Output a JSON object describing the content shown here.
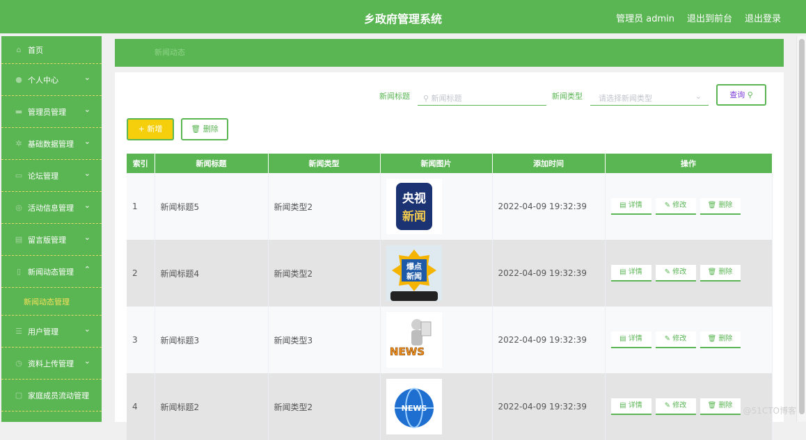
{
  "header": {
    "title": "乡政府管理系统",
    "user": "管理员 admin",
    "to_front": "退出到前台",
    "logout": "退出登录"
  },
  "sidebar": {
    "items": [
      {
        "label": "首页",
        "chevron": ""
      },
      {
        "label": "个人中心",
        "chevron": "⌄"
      },
      {
        "label": "管理员管理",
        "chevron": "⌄"
      },
      {
        "label": "基础数据管理",
        "chevron": "⌄"
      },
      {
        "label": "论坛管理",
        "chevron": "⌄"
      },
      {
        "label": "活动信息管理",
        "chevron": "⌄"
      },
      {
        "label": "留言版管理",
        "chevron": "⌄"
      },
      {
        "label": "新闻动态管理",
        "chevron": "⌃"
      },
      {
        "label": "用户管理",
        "chevron": "⌄"
      },
      {
        "label": "资料上传管理",
        "chevron": "⌄"
      },
      {
        "label": "家庭成员流动管理",
        "chevron": ""
      }
    ],
    "sub_item": "新闻动态管理"
  },
  "breadcrumb": "新闻动态",
  "search": {
    "title_label": "新闻标题",
    "title_placeholder": "新闻标题",
    "type_label": "新闻类型",
    "type_placeholder": "请选择新闻类型",
    "query_label": "查询"
  },
  "actions": {
    "add_label": "+ 新增",
    "delete_label": "删除"
  },
  "table": {
    "headers": [
      "索引",
      "新闻标题",
      "新闻类型",
      "新闻图片",
      "添加时间",
      "操作"
    ],
    "rows": [
      {
        "index": "1",
        "title": "新闻标题5",
        "type": "新闻类型2",
        "time": "2022-04-09 19:32:39",
        "image": "cctv-news"
      },
      {
        "index": "2",
        "title": "新闻标题4",
        "type": "新闻类型2",
        "time": "2022-04-09 19:32:39",
        "image": "hot-news"
      },
      {
        "index": "3",
        "title": "新闻标题3",
        "type": "新闻类型3",
        "time": "2022-04-09 19:32:39",
        "image": "news-reader"
      },
      {
        "index": "4",
        "title": "新闻标题2",
        "type": "新闻类型2",
        "time": "2022-04-09 19:32:39",
        "image": "news-globe"
      }
    ],
    "op_detail": "详情",
    "op_edit": "修改",
    "op_delete": "删除"
  },
  "image_text": {
    "cctv_top": "央视",
    "cctv_bottom": "新闻",
    "hot_top": "爆点",
    "hot_bottom": "新闻",
    "news_word": "NEWS"
  },
  "watermark": "@51CTO博客",
  "colors": {
    "primary": "#5ab553",
    "accent_yellow": "#f5cf0b",
    "query_text": "#7b3bd6"
  }
}
